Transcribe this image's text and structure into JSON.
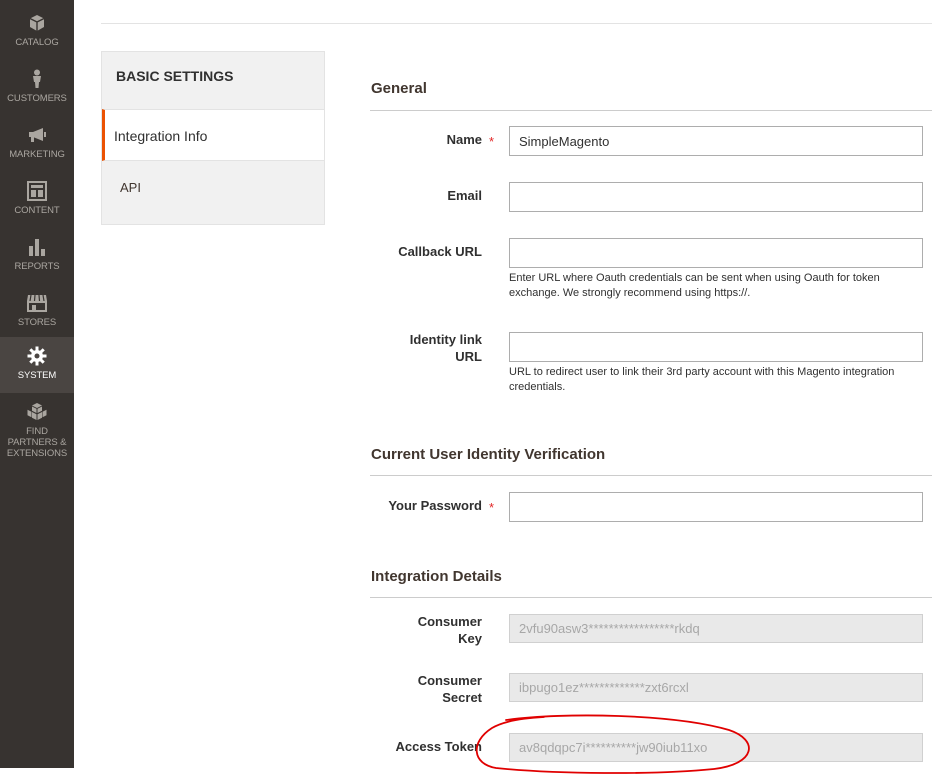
{
  "sidebar": {
    "items": [
      {
        "label": "CATALOG",
        "icon": "box-icon"
      },
      {
        "label": "CUSTOMERS",
        "icon": "person-icon"
      },
      {
        "label": "MARKETING",
        "icon": "megaphone-icon"
      },
      {
        "label": "CONTENT",
        "icon": "layout-icon"
      },
      {
        "label": "REPORTS",
        "icon": "bar-chart-icon"
      },
      {
        "label": "STORES",
        "icon": "storefront-icon"
      },
      {
        "label": "SYSTEM",
        "icon": "gear-icon"
      },
      {
        "label": "FIND PARTNERS & EXTENSIONS",
        "icon": "cubes-icon"
      }
    ],
    "active_index": 6
  },
  "tabs": {
    "title": "BASIC SETTINGS",
    "items": [
      {
        "label": "Integration Info",
        "active": true
      },
      {
        "label": "API",
        "active": false
      }
    ]
  },
  "general": {
    "title": "General",
    "name_label": "Name",
    "name_value": "SimpleMagento",
    "email_label": "Email",
    "email_value": "",
    "callback_label": "Callback URL",
    "callback_value": "",
    "callback_note": "Enter URL where Oauth credentials can be sent when using Oauth for token exchange. We strongly recommend using https://.",
    "identity_label_1": "Identity link",
    "identity_label_2": "URL",
    "identity_value": "",
    "identity_note": "URL to redirect user to link their 3rd party account with this Magento integration credentials."
  },
  "verification": {
    "title": "Current User Identity Verification",
    "password_label": "Your Password",
    "password_value": ""
  },
  "details": {
    "title": "Integration Details",
    "consumer_key_label_1": "Consumer",
    "consumer_key_label_2": "Key",
    "consumer_key_value": "2vfu90asw3*****************rkdq",
    "consumer_secret_label_1": "Consumer",
    "consumer_secret_label_2": "Secret",
    "consumer_secret_value": "ibpugo1ez*************zxt6rcxl",
    "access_token_label": "Access Token",
    "access_token_value": "av8qdqpc7i**********jw90iub11xo"
  },
  "colors": {
    "sidebar_bg": "#373330",
    "accent": "#eb5202",
    "required": "#e22626",
    "annotation": "#e00000"
  }
}
